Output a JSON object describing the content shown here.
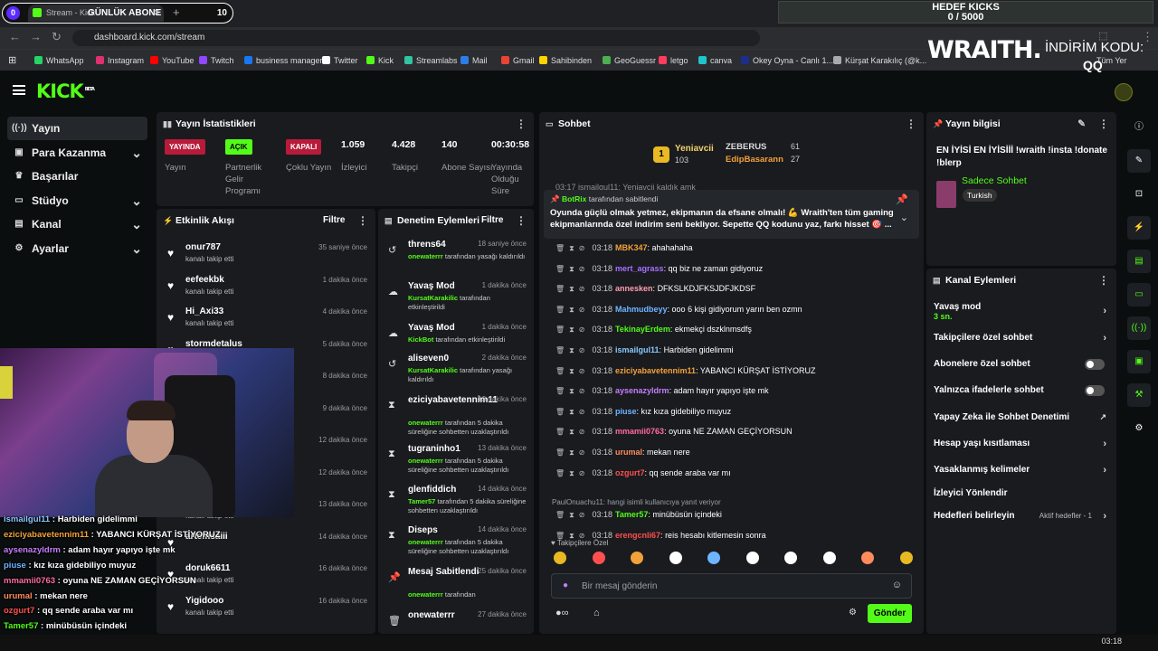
{
  "browser": {
    "tab_title": "Stream - Kick",
    "counter_badge": "0",
    "overlay_label": "GÜNLÜK ABONE",
    "overlay_count": "10",
    "url": "dashboard.kick.com/stream",
    "bookmarks": [
      "WhatsApp",
      "Instagram",
      "YouTube",
      "Twitch",
      "business manager",
      "Twitter",
      "Kick",
      "Streamlabs",
      "Mail",
      "Gmail",
      "Sahibinden",
      "GeoGuessr",
      "letgo",
      "canva",
      "Okey Oyna - Canlı 1...",
      "Kürşat Karakılıç (@k..."
    ],
    "bookmarks_tail": "Tüm Yer İşaretleri"
  },
  "goal": {
    "title": "HEDEF KICKS",
    "value": "0 / 5000"
  },
  "promo": {
    "brand": "WRAITH.",
    "code_label": "İNDİRİM KODU:",
    "code": "QQ"
  },
  "header": {
    "logo": "KICK",
    "beta": "BETA"
  },
  "sidebar": {
    "items": [
      {
        "label": "Yayın",
        "icon": "broadcast-icon",
        "active": true
      },
      {
        "label": "Para Kazanma",
        "icon": "money-icon",
        "chevron": true
      },
      {
        "label": "Başarılar",
        "icon": "trophy-icon"
      },
      {
        "label": "Stüdyo",
        "icon": "studio-icon",
        "chevron": true
      },
      {
        "label": "Kanal",
        "icon": "channel-icon",
        "chevron": true
      },
      {
        "label": "Ayarlar",
        "icon": "gear-icon",
        "chevron": true
      }
    ]
  },
  "stats": {
    "title": "Yayın İstatistikleri",
    "cols": [
      {
        "value": "YAYINDA",
        "label": "Yayın",
        "badge": "red"
      },
      {
        "value": "AÇIK",
        "label": "Partnerlik Gelir Programı",
        "badge": "green"
      },
      {
        "value": "KAPALI",
        "label": "Çoklu Yayın",
        "badge": "red"
      },
      {
        "value": "1.059",
        "label": "İzleyici"
      },
      {
        "value": "4.428",
        "label": "Takipçi"
      },
      {
        "value": "140",
        "label": "Abone Sayısı"
      },
      {
        "value": "00:30:58",
        "label": "Yayında Olduğu Süre"
      }
    ]
  },
  "events": {
    "title": "Etkinlik Akışı",
    "filter": "Filtre",
    "items": [
      {
        "name": "onur787",
        "sub": "kanalı takip etti",
        "time": "35 saniye önce"
      },
      {
        "name": "eefeekbk",
        "sub": "kanalı takip etti",
        "time": "1 dakika önce"
      },
      {
        "name": "Hi_Axi33",
        "sub": "kanalı takip etti",
        "time": "4 dakika önce"
      },
      {
        "name": "stormdetalus",
        "sub": "kanalı takip etti",
        "time": "5 dakika önce"
      },
      {
        "name": "",
        "sub": "",
        "time": "8 dakika önce"
      },
      {
        "name": "",
        "sub": "",
        "time": "9 dakika önce"
      },
      {
        "name": "",
        "sub": "",
        "time": "12 dakika önce"
      },
      {
        "name": "",
        "sub": "",
        "time": "12 dakika önce"
      },
      {
        "name": "",
        "sub": "kanalı takip etti",
        "time": "13 dakika önce"
      },
      {
        "name": "artemsaiii",
        "sub": "",
        "time": "14 dakika önce"
      },
      {
        "name": "doruk6611",
        "sub": "kanalı takip etti",
        "time": "16 dakika önce"
      },
      {
        "name": "Yigidooo",
        "sub": "kanalı takip etti",
        "time": "16 dakika önce"
      }
    ]
  },
  "audit": {
    "title": "Denetim Eylemleri",
    "filter": "Filtre",
    "items": [
      {
        "name": "threns64",
        "time": "18 saniye önce",
        "by": "onewaterrr",
        "desc": "tarafından yasağı kaldırıldı"
      },
      {
        "name": "Yavaş Mod",
        "time": "1 dakika önce",
        "by": "KursatKarakilic",
        "desc": "tarafından etkinleştirildi"
      },
      {
        "name": "Yavaş Mod",
        "time": "1 dakika önce",
        "by": "KickBot",
        "desc": "tarafından etkinleştirildi"
      },
      {
        "name": "aliseven0",
        "time": "2 dakika önce",
        "by": "KursatKarakilic",
        "desc": "tarafından yasağı kaldırıldı"
      },
      {
        "name": "eziciyabavetennim11",
        "time": "13 dakika önce",
        "by": "onewaterrr",
        "desc": "tarafından 5 dakika süreliğine sohbetten uzaklaştırıldı"
      },
      {
        "name": "tugraninho1",
        "time": "13 dakika önce",
        "by": "onewaterrr",
        "desc": "tarafından 5 dakika süreliğine sohbetten uzaklaştırıldı"
      },
      {
        "name": "glenfiddich",
        "time": "14 dakika önce",
        "by": "Tamer57",
        "desc": "tarafından 5 dakika süreliğine sohbetten uzaklaştırıldı"
      },
      {
        "name": "Diseps",
        "time": "14 dakika önce",
        "by": "onewaterrr",
        "desc": "tarafından 5 dakika süreliğine sohbetten uzaklaştırıldı"
      },
      {
        "name": "Mesaj Sabitlendi",
        "time": "25 dakika önce",
        "by": "onewaterrr",
        "desc": "tarafından"
      },
      {
        "name": "onewaterrr",
        "time": "27 dakika önce",
        "by": "",
        "desc": ""
      }
    ]
  },
  "chat": {
    "title": "Sohbet",
    "leaders": [
      {
        "name": "Yeniavcii",
        "val": "103"
      },
      {
        "name": "ZEBERUS",
        "val": "61"
      },
      {
        "name": "EdipBasarann",
        "val": "27"
      }
    ],
    "rank": "1",
    "cut_top": "03:17 ismailgul11: Yeniavcii kaldık amk",
    "pinned": {
      "by": "BotRix",
      "by_suffix": "tarafından sabitlendi",
      "text": "Oyunda güçlü olmak yetmez, ekipmanın da efsane olmalı! 💪 Wraith'ten tüm gaming ekipmanlarında özel indirim seni bekliyor. Sepette QQ kodunu yaz, farkı hisset 🎯 ..."
    },
    "messages": [
      {
        "time": "03:18",
        "user": "MBK347",
        "color": "#f3a13a",
        "text": "ahahahaha"
      },
      {
        "time": "03:18",
        "user": "mert_agrass",
        "color": "#a970ff",
        "text": "qq biz ne zaman gidiyoruz"
      },
      {
        "time": "03:18",
        "user": "annesken",
        "color": "#ff9db0",
        "text": "DFKSLKDJFKSJDFJKDSF"
      },
      {
        "time": "03:18",
        "user": "Mahmudbeyy",
        "color": "#6eb5ff",
        "text": "ooo 6 kişi gidiyorum yarın ben ozmn"
      },
      {
        "time": "03:18",
        "user": "TekinayErdem",
        "color": "#53fc18",
        "text": "ekmekçi dszklnmsdfş"
      },
      {
        "time": "03:18",
        "user": "ismailgul11",
        "color": "#8bc8ff",
        "text": "Harbiden gidelimmi"
      },
      {
        "time": "03:18",
        "user": "eziciyabavetennim11",
        "color": "#f3a13a",
        "text": "YABANCI KÜRŞAT İSTİYORUZ"
      },
      {
        "time": "03:18",
        "user": "aysenazyldrm",
        "color": "#c77dff",
        "text": "adam hayır yapıyo işte mk"
      },
      {
        "time": "03:18",
        "user": "piuse",
        "color": "#6eb5ff",
        "text": "kız kıza gidebiliyo muyuz"
      },
      {
        "time": "03:18",
        "user": "mmamii0763",
        "color": "#ff6b9d",
        "text": "oyuna NE ZAMAN GEÇİYORSUN"
      },
      {
        "time": "03:18",
        "user": "urumal",
        "color": "#ff8a5c",
        "text": "mekan nere"
      },
      {
        "time": "03:18",
        "user": "ozgurt7",
        "color": "#ff5050",
        "text": "qq sende araba var mı"
      }
    ],
    "reply_hint": "PaulOnuachu11: hangi isimli kullanıcıya yanıt veriyor",
    "messages2": [
      {
        "time": "03:18",
        "user": "Tamer57",
        "color": "#53fc18",
        "text": "minübüsün içindeki"
      },
      {
        "time": "03:18",
        "user": "erengcnli67",
        "color": "#ff5050",
        "text": "reis hesabı kitlemesin sonra"
      }
    ],
    "followers_only": "Takipçilere Özel",
    "placeholder": "Bir mesaj gönderin",
    "send": "Gönder"
  },
  "info": {
    "title": "Yayın bilgisi",
    "stream_title": "EN İYİSİ EN İYİSİİİ !wraith !insta !donate !blerp",
    "category": "Sadece Sohbet",
    "lang": "Turkish"
  },
  "actions": {
    "title": "Kanal Eylemleri",
    "slow_label": "Yavaş mod",
    "slow_val": "3 sn.",
    "items": [
      "Takipçilere özel sohbet",
      "Abonelere özel sohbet",
      "Yalnızca ifadelerle sohbet",
      "Yapay Zeka ile Sohbet Denetimi",
      "Hesap yaşı kısıtlaması",
      "Yasaklanmış kelimeler",
      "İzleyici Yönlendir",
      "Hedefleri belirleyin"
    ],
    "goals_badge": "Aktif hedefler - 1"
  },
  "overlay_chat": [
    {
      "user": "ismailgul11",
      "color": "#8bc8ff",
      "text": "Harbiden gidelimmi"
    },
    {
      "user": "eziciyabavetennim11",
      "color": "#f3a13a",
      "text": "YABANCI KÜRŞAT İSTİYORUZ"
    },
    {
      "user": "aysenazyldrm",
      "color": "#c77dff",
      "text": "adam hayır yapıyo işte mk"
    },
    {
      "user": "piuse",
      "color": "#6eb5ff",
      "text": "kız kıza gidebiliyo muyuz"
    },
    {
      "user": "mmamii0763",
      "color": "#ff6b9d",
      "text": "oyuna NE ZAMAN GEÇİYORSUN"
    },
    {
      "user": "urumal",
      "color": "#ff8a5c",
      "text": "mekan nere"
    },
    {
      "user": "ozgurt7",
      "color": "#ff5050",
      "text": "qq sende araba var mı"
    },
    {
      "user": "Tamer57",
      "color": "#53fc18",
      "text": "minübüsün içindeki"
    },
    {
      "user": "erengcnli67",
      "color": "#ff5050",
      "text": "reis hesabı kitlemesin sonra"
    }
  ],
  "clock": "03:18",
  "colors": {
    "accent": "#53fc18",
    "panel": "#191b1f",
    "bg": "#0b0e0f",
    "red": "#b81b3a"
  }
}
